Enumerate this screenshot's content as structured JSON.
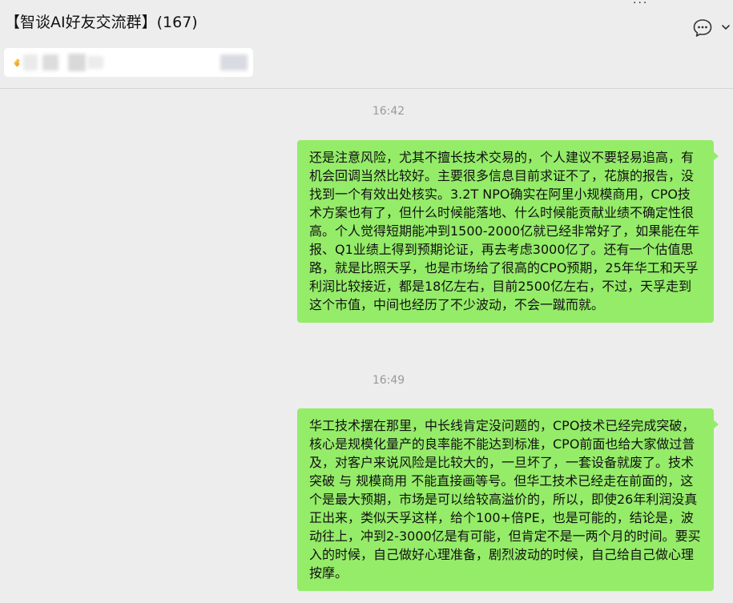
{
  "header": {
    "title": "【智谈AI好友交流群】(167)",
    "top_dots": "···"
  },
  "icons": {
    "chat_bubble": "chat-bubble-icon",
    "chevron": "chevron-down-icon",
    "pinned": "pinned-message-icon"
  },
  "colors": {
    "background": "#ededed",
    "bubble": "#95ec69",
    "timestamp": "#9a9a9a"
  },
  "messages": [
    {
      "time": "16:42",
      "text": "还是注意风险，尤其不擅长技术交易的，个人建议不要轻易追高，有机会回调当然比较好。主要很多信息目前求证不了，花旗的报告，没找到一个有效出处核实。3.2T NPO确实在阿里小规模商用，CPO技术方案也有了，但什么时候能落地、什么时候能贡献业绩不确定性很高。个人觉得短期能冲到1500-2000亿就已经非常好了，如果能在年报、Q1业绩上得到预期论证，再去考虑3000亿了。还有一个估值思路，就是比照天孚，也是市场给了很高的CPO预期，25年华工和天孚利润比较接近，都是18亿左右，目前2500亿左右，不过，天孚走到这个市值，中间也经历了不少波动，不会一蹴而就。"
    },
    {
      "time": "16:49",
      "text": "华工技术摆在那里，中长线肯定没问题的，CPO技术已经完成突破，核心是规模化量产的良率能不能达到标准，CPO前面也给大家做过普及，对客户来说风险是比较大的，一旦坏了，一套设备就废了。技术突破 与 规模商用 不能直接画等号。但华工技术已经走在前面的，这个是最大预期，市场是可以给较高溢价的，所以，即使26年利润没真正出来，类似天孚这样，给个100+倍PE，也是可能的，结论是，波动往上，冲到2-3000亿是有可能，但肯定不是一两个月的时间。要买入的时候，自己做好心理准备，剧烈波动的时候，自己给自己做心理按摩。"
    }
  ]
}
